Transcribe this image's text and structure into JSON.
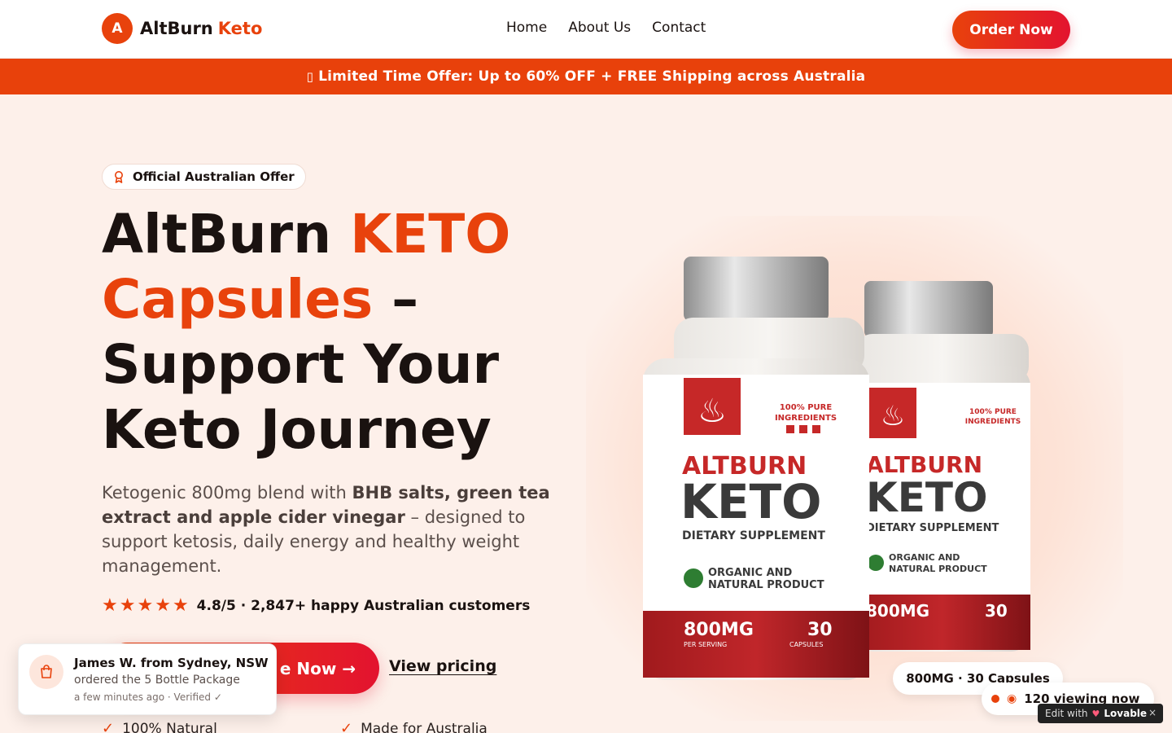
{
  "header": {
    "logo_letter": "A",
    "brand_name": "AltBurn",
    "brand_accent": "Keto",
    "nav": [
      {
        "label": "Home"
      },
      {
        "label": "About Us"
      },
      {
        "label": "Contact"
      }
    ],
    "order_button": "Order Now"
  },
  "banner": {
    "icon": "▯",
    "text": "Limited Time Offer: Up to 60% OFF + FREE Shipping across Australia"
  },
  "hero": {
    "badge": "Official Australian Offer",
    "title_part1": "AltBurn ",
    "title_accent": "KETO Capsules",
    "title_part2": " – Support Your Keto Journey",
    "desc_lead": "Ketogenic 800mg blend with ",
    "desc_bold": "BHB salts, green tea extract and apple cider vinegar",
    "desc_tail": " – designed to support ketosis, daily energy and healthy weight management.",
    "rating_text": "4.8/5 · 2,847+ happy Australian customers",
    "star_count": 5,
    "cta_primary": "e Now →",
    "cta_secondary": "View pricing",
    "features": [
      "100% Natural",
      "Made for Australia"
    ]
  },
  "product": {
    "tag": "800MG · 30 Capsules",
    "viewing": "120 viewing now",
    "bottle_brand": "ALTBURN",
    "bottle_name": "KETO",
    "bottle_sub": "DIETARY SUPPLEMENT",
    "bottle_badge_line1": "ORGANIC AND",
    "bottle_badge_line2": "NATURAL PRODUCT",
    "bottle_dose": "800MG",
    "bottle_dose_sub": "PER SERVING",
    "bottle_count": "30",
    "bottle_count_sub": "CAPSULES",
    "bottle_pure_line1": "100% PURE",
    "bottle_pure_line2": "INGREDIENTS"
  },
  "toast": {
    "name": "James W. from Sydney, NSW",
    "action": "ordered the 5 Bottle Package",
    "meta": "a few minutes ago · Verified ✓"
  },
  "edit_pill": {
    "prefix": "Edit with",
    "brand": "Lovable",
    "close": "×"
  },
  "colors": {
    "accent": "#e8420c",
    "accent_red": "#e3132f",
    "background": "#fdf0ea"
  },
  "icons": [
    "award-icon",
    "star-icon",
    "check-icon",
    "shopping-bag-icon",
    "eye-icon",
    "close-icon"
  ]
}
